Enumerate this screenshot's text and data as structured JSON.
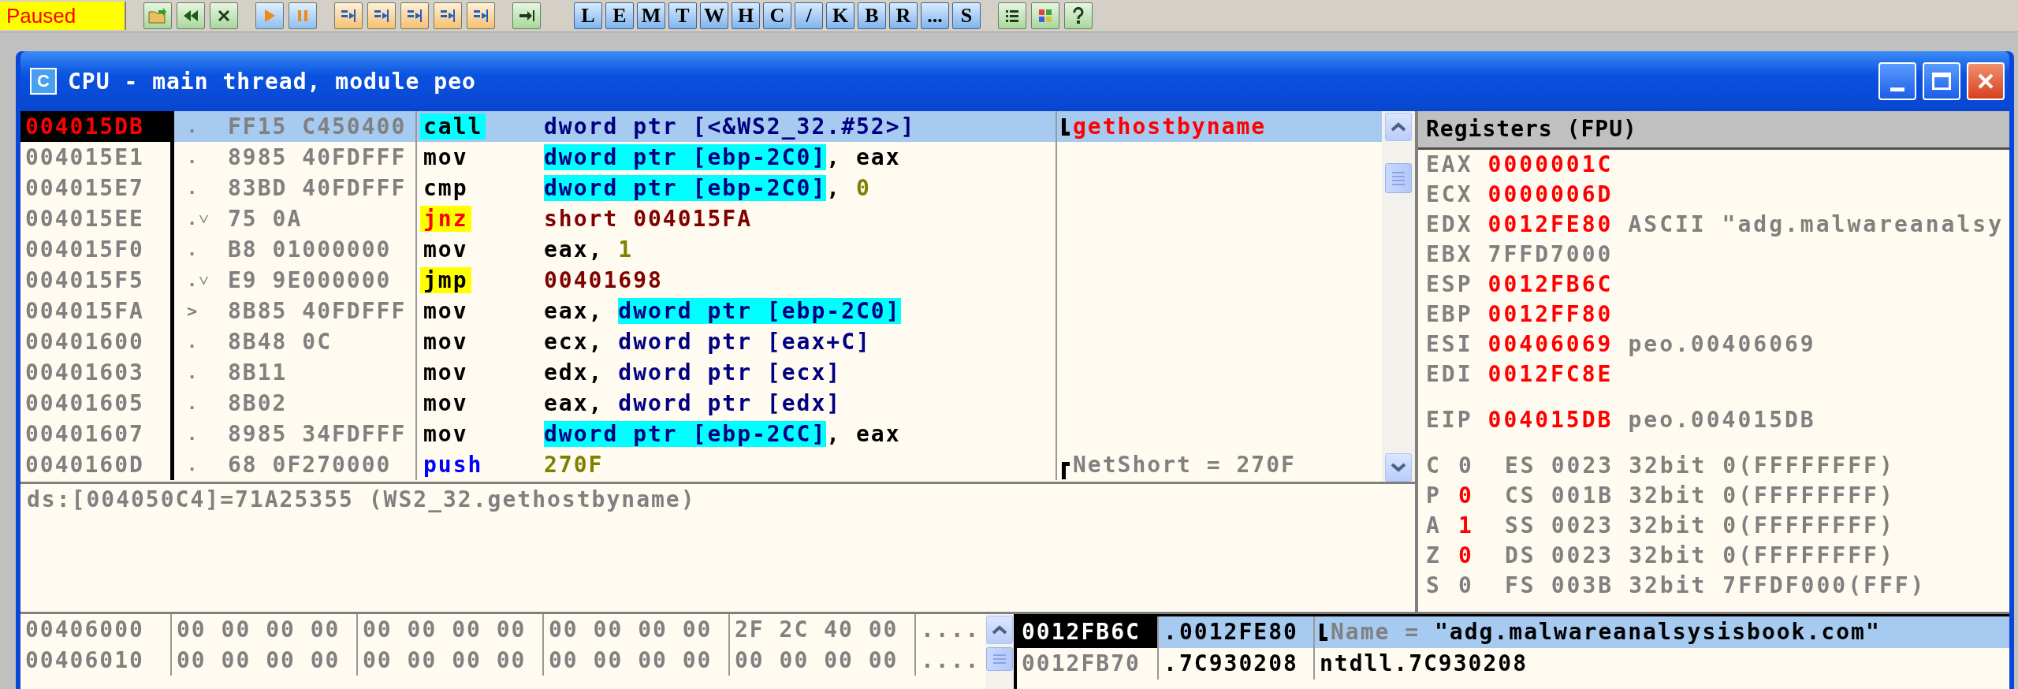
{
  "toolbar": {
    "status": "Paused",
    "letter_buttons": [
      "L",
      "E",
      "M",
      "T",
      "W",
      "H",
      "C",
      "/",
      "K",
      "B",
      "R",
      "...",
      "S"
    ]
  },
  "window": {
    "icon_letter": "C",
    "title": "CPU - main thread, module peo"
  },
  "disasm": {
    "rows": [
      {
        "address": "004015DB",
        "eip": true,
        "selected": true,
        "mark": ".",
        "bytes": "FF15 C450400",
        "mnemonic": "call",
        "kind": "call",
        "operands": [
          {
            "text": "dword ptr [<&WS2_32.#52>]",
            "kind": "mem"
          }
        ],
        "comment": {
          "kind": "call_end",
          "text": "gethostbyname"
        }
      },
      {
        "address": "004015E1",
        "eip": false,
        "selected": false,
        "mark": ".",
        "bytes": "8985 40FDFFF",
        "mnemonic": "mov",
        "kind": "plain",
        "operands": [
          {
            "text": "dword ptr [ebp-2C0]",
            "kind": "mem_hl"
          },
          {
            "text": ", eax",
            "kind": "text"
          }
        ]
      },
      {
        "address": "004015E7",
        "eip": false,
        "selected": false,
        "mark": ".",
        "bytes": "83BD 40FDFFF",
        "mnemonic": "cmp",
        "kind": "plain",
        "operands": [
          {
            "text": "dword ptr [ebp-2C0]",
            "kind": "mem_hl"
          },
          {
            "text": ", ",
            "kind": "text"
          },
          {
            "text": "0",
            "kind": "const"
          }
        ]
      },
      {
        "address": "004015EE",
        "eip": false,
        "selected": false,
        "mark": ".˅",
        "bytes": "75 0A",
        "mnemonic": "jnz",
        "kind": "cond_jump",
        "operands": [
          {
            "text": "short 004015FA",
            "kind": "target"
          }
        ]
      },
      {
        "address": "004015F0",
        "eip": false,
        "selected": false,
        "mark": ".",
        "bytes": "B8 01000000",
        "mnemonic": "mov",
        "kind": "plain",
        "operands": [
          {
            "text": "eax, ",
            "kind": "text"
          },
          {
            "text": "1",
            "kind": "const"
          }
        ]
      },
      {
        "address": "004015F5",
        "eip": false,
        "selected": false,
        "mark": ".˅",
        "bytes": "E9 9E000000",
        "mnemonic": "jmp",
        "kind": "jump",
        "operands": [
          {
            "text": "00401698",
            "kind": "target"
          }
        ]
      },
      {
        "address": "004015FA",
        "eip": false,
        "selected": false,
        "mark": ">",
        "bytes": "8B85 40FDFFF",
        "mnemonic": "mov",
        "kind": "plain",
        "operands": [
          {
            "text": "eax, ",
            "kind": "text"
          },
          {
            "text": "dword ptr [ebp-2C0]",
            "kind": "mem_hl"
          }
        ]
      },
      {
        "address": "00401600",
        "eip": false,
        "selected": false,
        "mark": ".",
        "bytes": "8B48 0C",
        "mnemonic": "mov",
        "kind": "plain",
        "operands": [
          {
            "text": "ecx, ",
            "kind": "text"
          },
          {
            "text": "dword ptr [eax+C]",
            "kind": "mem"
          }
        ]
      },
      {
        "address": "00401603",
        "eip": false,
        "selected": false,
        "mark": ".",
        "bytes": "8B11",
        "mnemonic": "mov",
        "kind": "plain",
        "operands": [
          {
            "text": "edx, ",
            "kind": "text"
          },
          {
            "text": "dword ptr [ecx]",
            "kind": "mem"
          }
        ]
      },
      {
        "address": "00401605",
        "eip": false,
        "selected": false,
        "mark": ".",
        "bytes": "8B02",
        "mnemonic": "mov",
        "kind": "plain",
        "operands": [
          {
            "text": "eax, ",
            "kind": "text"
          },
          {
            "text": "dword ptr [edx]",
            "kind": "mem"
          }
        ]
      },
      {
        "address": "00401607",
        "eip": false,
        "selected": false,
        "mark": ".",
        "bytes": "8985 34FDFFF",
        "mnemonic": "mov",
        "kind": "plain",
        "operands": [
          {
            "text": "dword ptr [ebp-2CC]",
            "kind": "mem_hl"
          },
          {
            "text": ", eax",
            "kind": "text"
          }
        ]
      },
      {
        "address": "0040160D",
        "eip": false,
        "selected": false,
        "mark": ".",
        "bytes": "68 0F270000",
        "mnemonic": "push",
        "kind": "push",
        "operands": [
          {
            "text": "270F",
            "kind": "const"
          }
        ],
        "comment": {
          "kind": "arg_start",
          "text": "NetShort = 270F"
        }
      }
    ]
  },
  "info": {
    "text": "ds:[004050C4]=71A25355 (WS2_32.gethostbyname)"
  },
  "registers": {
    "title": "Registers (FPU)",
    "general": [
      {
        "name": "EAX",
        "value": "0000001C",
        "changed": true
      },
      {
        "name": "ECX",
        "value": "0000006D",
        "changed": true
      },
      {
        "name": "EDX",
        "value": "0012FE80",
        "changed": true,
        "note": "ASCII \"adg.malwareanalsy"
      },
      {
        "name": "EBX",
        "value": "7FFD7000",
        "changed": false
      },
      {
        "name": "ESP",
        "value": "0012FB6C",
        "changed": true
      },
      {
        "name": "EBP",
        "value": "0012FF80",
        "changed": true
      },
      {
        "name": "ESI",
        "value": "00406069",
        "changed": true,
        "note": "peo.00406069"
      },
      {
        "name": "EDI",
        "value": "0012FC8E",
        "changed": true
      }
    ],
    "eip": {
      "name": "EIP",
      "value": "004015DB",
      "changed": true,
      "note": "peo.004015DB"
    },
    "flags": [
      {
        "flag": "C",
        "value": "0",
        "changed": false,
        "segment": "ES",
        "selector": "0023",
        "info": "32bit 0(FFFFFFFF)"
      },
      {
        "flag": "P",
        "value": "0",
        "changed": true,
        "segment": "CS",
        "selector": "001B",
        "info": "32bit 0(FFFFFFFF)"
      },
      {
        "flag": "A",
        "value": "1",
        "changed": true,
        "segment": "SS",
        "selector": "0023",
        "info": "32bit 0(FFFFFFFF)"
      },
      {
        "flag": "Z",
        "value": "0",
        "changed": true,
        "segment": "DS",
        "selector": "0023",
        "info": "32bit 0(FFFFFFFF)"
      },
      {
        "flag": "S",
        "value": "0",
        "changed": false,
        "segment": "FS",
        "selector": "003B",
        "info": "32bit 7FFDF000(FFF)"
      }
    ]
  },
  "dump": {
    "rows": [
      {
        "address": "00406000",
        "groups": [
          "00 00 00 00",
          "00 00 00 00",
          "00 00 00 00",
          "2F 2C 40 00"
        ],
        "ascii": "...."
      },
      {
        "address": "00406010",
        "groups": [
          "00 00 00 00",
          "00 00 00 00",
          "00 00 00 00",
          "00 00 00 00"
        ],
        "ascii": "...."
      }
    ]
  },
  "stack": {
    "rows": [
      {
        "address": "0012FB6C",
        "top": true,
        "selected": true,
        "prefix": ".",
        "value": "0012FE80",
        "comment": {
          "kind": "arg_end",
          "parts": [
            {
              "text": "Name = ",
              "kind": "arg"
            },
            {
              "text": "\"adg.malwareanalsysisbook.com\"",
              "kind": "str"
            }
          ]
        }
      },
      {
        "address": "0012FB70",
        "top": false,
        "selected": false,
        "prefix": ".",
        "value": "7C930208",
        "comment": {
          "kind": "plain",
          "parts": [
            {
              "text": "ntdll.7C930208",
              "kind": "plain"
            }
          ]
        }
      }
    ]
  }
}
